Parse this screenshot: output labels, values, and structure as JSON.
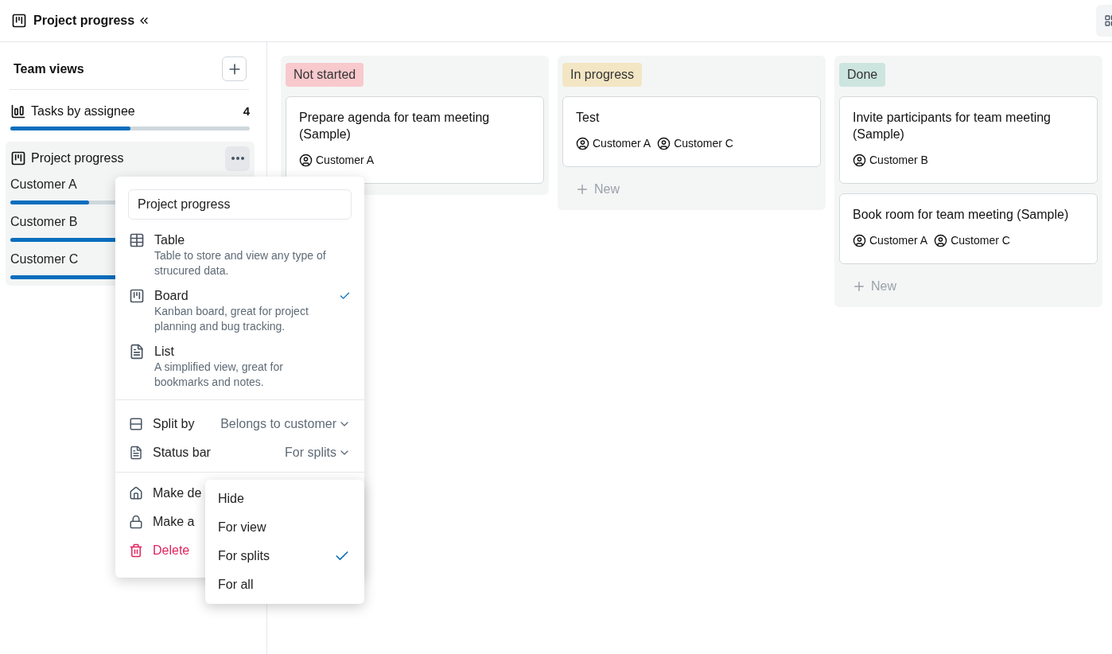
{
  "header": {
    "title": "Project progress"
  },
  "sidebar": {
    "title": "Team views",
    "views": [
      {
        "name": "Tasks by assignee",
        "count": "4",
        "level": 0.5,
        "selected": false,
        "kind": "assignee"
      },
      {
        "name": "Project progress",
        "selected": true,
        "kind": "board",
        "splits": [
          {
            "name": "Customer A",
            "level": 0.33
          },
          {
            "name": "Customer B",
            "level": 1
          },
          {
            "name": "Customer C",
            "level": 0.5
          }
        ]
      }
    ]
  },
  "menu": {
    "name_value": "Project progress",
    "layouts": [
      {
        "kind": "table",
        "title": "Table",
        "description": "Table to store and view any type of strucured data.",
        "selected": false
      },
      {
        "kind": "board",
        "title": "Board",
        "description": "Kanban board, great for project planning and bug tracking.",
        "selected": true
      },
      {
        "kind": "list",
        "title": "List",
        "description": "A simplified view, great for bookmarks and notes.",
        "selected": false
      }
    ],
    "settings": [
      {
        "kind": "split",
        "label": "Split by",
        "value": "Belongs to customer"
      },
      {
        "kind": "status",
        "label": "Status bar",
        "value": "For splits"
      }
    ],
    "actions": [
      {
        "kind": "home",
        "label": "Make de"
      },
      {
        "kind": "lock",
        "label": "Make a"
      },
      {
        "kind": "delete",
        "label": "Delete"
      }
    ],
    "submenu": [
      {
        "label": "Hide",
        "selected": false
      },
      {
        "label": "For view",
        "selected": false
      },
      {
        "label": "For splits",
        "selected": true
      },
      {
        "label": "For all",
        "selected": false
      }
    ]
  },
  "board": {
    "columns": [
      {
        "title": "Not started",
        "color": "#f8c9cd",
        "cards": [
          {
            "title": "Prepare agenda for team meeting (Sample)",
            "customers": [
              "Customer A"
            ]
          }
        ]
      },
      {
        "title": "In progress",
        "color": "#f3e6c4",
        "cards": [
          {
            "title": "Test",
            "customers": [
              "Customer A",
              "Customer C"
            ]
          }
        ],
        "new_label": "New"
      },
      {
        "title": "Done",
        "color": "#cde5df",
        "cards": [
          {
            "title": "Invite participants for team meeting (Sample)",
            "customers": [
              "Customer B"
            ]
          },
          {
            "title": "Book room for team meeting (Sample)",
            "customers": [
              "Customer A",
              "Customer C"
            ]
          }
        ],
        "new_label": "New"
      }
    ]
  }
}
